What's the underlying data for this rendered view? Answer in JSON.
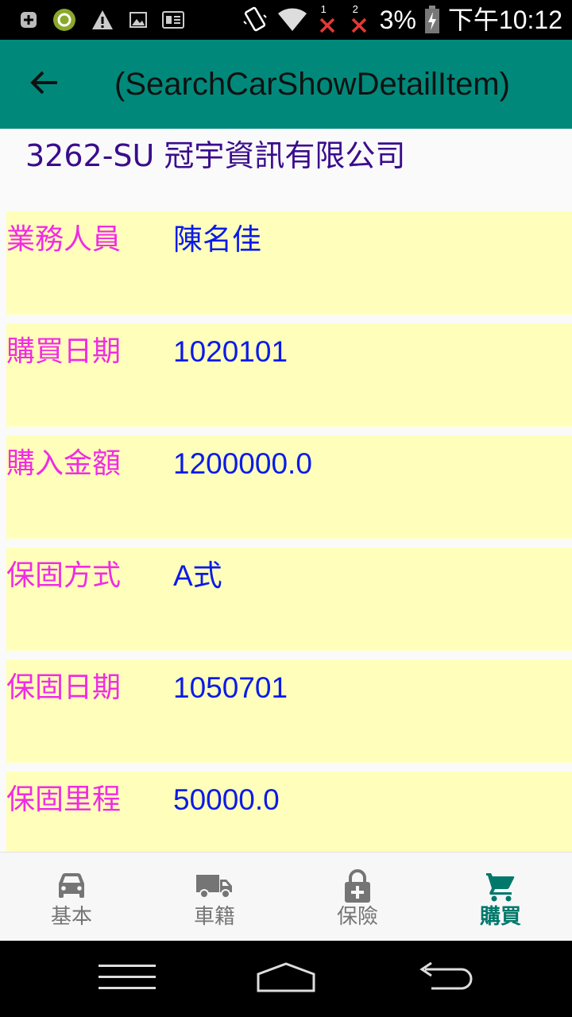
{
  "status_bar": {
    "battery_percent": "3%",
    "time": "下午10:12",
    "sim1_label": "1",
    "sim2_label": "2",
    "notification_icons": [
      "plus-box-icon",
      "green-circle-app-icon",
      "warning-icon",
      "image-icon",
      "ge-app-icon"
    ],
    "right_icons": [
      "vibrate-icon",
      "wifi-icon",
      "signal-sim1-x-icon",
      "signal-sim2-x-icon",
      "battery-charging-icon"
    ]
  },
  "app_bar": {
    "back_icon": "arrow-back-icon",
    "title": "(SearchCarShowDetailItem)"
  },
  "header": {
    "title": "3262-SU 冠宇資訊有限公司"
  },
  "rows": [
    {
      "label": "業務人員",
      "value": "陳名佳"
    },
    {
      "label": "購買日期",
      "value": "1020101"
    },
    {
      "label": "購入金額",
      "value": "1200000.0"
    },
    {
      "label": "保固方式",
      "value": "A式"
    },
    {
      "label": "保固日期",
      "value": "1050701"
    },
    {
      "label": "保固里程",
      "value": "50000.0"
    }
  ],
  "bottom_nav": {
    "items": [
      {
        "label": "基本",
        "icon": "car-icon",
        "active": false
      },
      {
        "label": "車籍",
        "icon": "truck-icon",
        "active": false
      },
      {
        "label": "保險",
        "icon": "lock-plus-icon",
        "active": false
      },
      {
        "label": "購買",
        "icon": "cart-icon",
        "active": true
      }
    ]
  },
  "system_nav": {
    "icons": [
      "menu-icon",
      "home-icon",
      "back-icon"
    ]
  },
  "colors": {
    "app_bar": "#00897B",
    "row_background": "#FFFFBB",
    "label_text": "#F02CE3",
    "value_text": "#0A1BE8",
    "header_text": "#3A0C8C",
    "active_tab": "#00796B",
    "inactive_tab": "#757575"
  }
}
